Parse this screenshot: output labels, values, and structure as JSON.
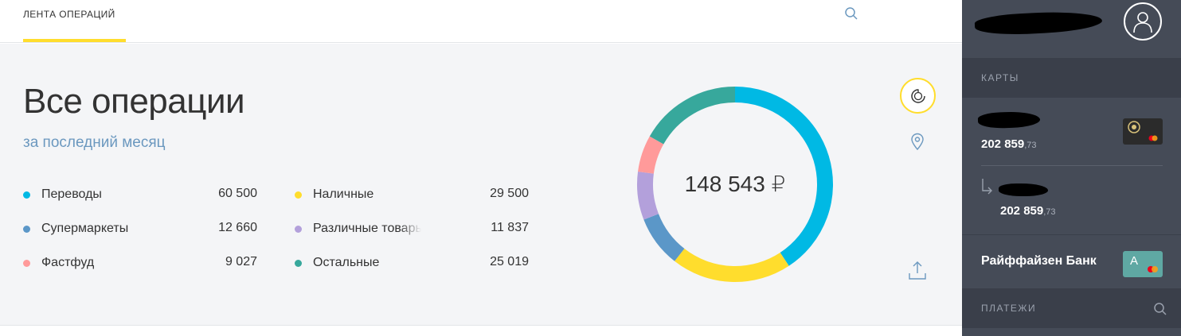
{
  "top_tab": {
    "label": "ЛЕНТА ОПЕРАЦИЙ"
  },
  "main": {
    "title": "Все операции",
    "period_link": "за последний месяц",
    "total": "148 543 ₽"
  },
  "categories": [
    {
      "label": "Переводы",
      "value": "60 500",
      "color": "#00b9e4"
    },
    {
      "label": "Супермаркеты",
      "value": "12 660",
      "color": "#5b97c8"
    },
    {
      "label": "Фастфуд",
      "value": "9 027",
      "color": "#ff9a9a"
    },
    {
      "label": "Наличные",
      "value": "29 500",
      "color": "#ffdd2d"
    },
    {
      "label": "Различные товары",
      "value": "11 837",
      "color": "#b3a0db"
    },
    {
      "label": "Остальные",
      "value": "25 019",
      "color": "#37a89c"
    }
  ],
  "sidebar": {
    "cards_label": "КАРТЫ",
    "card1": {
      "balance_main": "202 859",
      "balance_cents": ",73"
    },
    "card2": {
      "balance_main": "202 859",
      "balance_cents": ",73"
    },
    "bank": {
      "name": "Райффайзен Банк",
      "card_letter": "A"
    },
    "payments_label": "ПЛАТЕЖИ"
  },
  "icons": {
    "top_search": "search-icon",
    "chart_toggle": "pie-chart-icon",
    "map_pin": "map-pin-icon",
    "export": "upload-icon",
    "avatar": "user-icon",
    "payments_search": "search-icon"
  }
}
